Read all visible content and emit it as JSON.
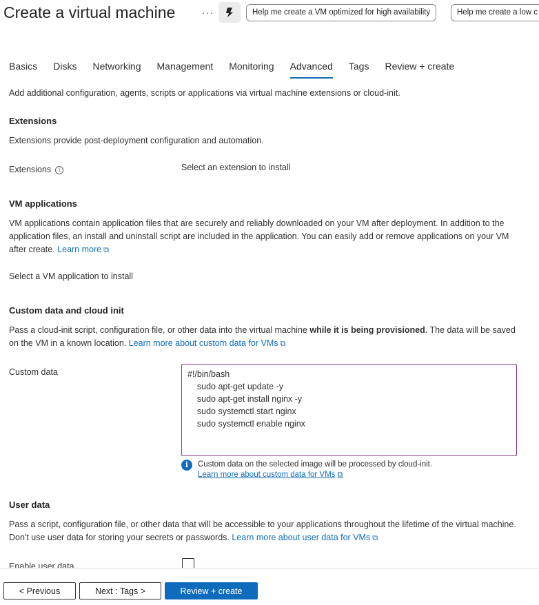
{
  "header": {
    "title": "Create a virtual machine",
    "more": "···",
    "suggestions": [
      "Help me create a VM optimized for high availability",
      "Help me create a low c"
    ]
  },
  "tabs": [
    {
      "label": "Basics"
    },
    {
      "label": "Disks"
    },
    {
      "label": "Networking"
    },
    {
      "label": "Management"
    },
    {
      "label": "Monitoring"
    },
    {
      "label": "Advanced",
      "active": true
    },
    {
      "label": "Tags"
    },
    {
      "label": "Review + create"
    }
  ],
  "intro": "Add additional configuration, agents, scripts or applications via virtual machine extensions or cloud-init.",
  "extensions": {
    "heading": "Extensions",
    "description": "Extensions provide post-deployment configuration and automation.",
    "field_label": "Extensions",
    "link": "Select an extension to install"
  },
  "vm_applications": {
    "heading": "VM applications",
    "description": "VM applications contain application files that are securely and reliably downloaded on your VM after deployment. In addition to the application files, an install and uninstall script are included in the application. You can easily add or remove applications on your VM after create.",
    "learn_more": "Learn more",
    "link": "Select a VM application to install"
  },
  "custom_data": {
    "heading": "Custom data and cloud init",
    "description_pre": "Pass a cloud-init script, configuration file, or other data into the virtual machine ",
    "description_bold": "while it is being provisioned",
    "description_post": ". The data will be saved on the VM in a known location.",
    "learn_more": "Learn more about custom data for VMs",
    "field_label": "Custom data",
    "value": "#!/bin/bash\n    sudo apt-get update -y\n    sudo apt-get install nginx -y\n    sudo systemctl start nginx\n    sudo systemctl enable nginx",
    "note": "Custom data on the selected image will be processed by cloud-init.",
    "note_link": "Learn more about custom data for VMs"
  },
  "user_data": {
    "heading": "User data",
    "description": "Pass a script, configuration file, or other data that will be accessible to your applications throughout the lifetime of the virtual machine. Don't use user data for storing your secrets or passwords.",
    "learn_more": "Learn more about user data for VMs",
    "enable_label": "Enable user data"
  },
  "footer": {
    "previous": "< Previous",
    "next": "Next : Tags >",
    "review": "Review + create"
  },
  "colors": {
    "accent": "#0f6cbd",
    "textarea_border": "#8a3a8a"
  }
}
